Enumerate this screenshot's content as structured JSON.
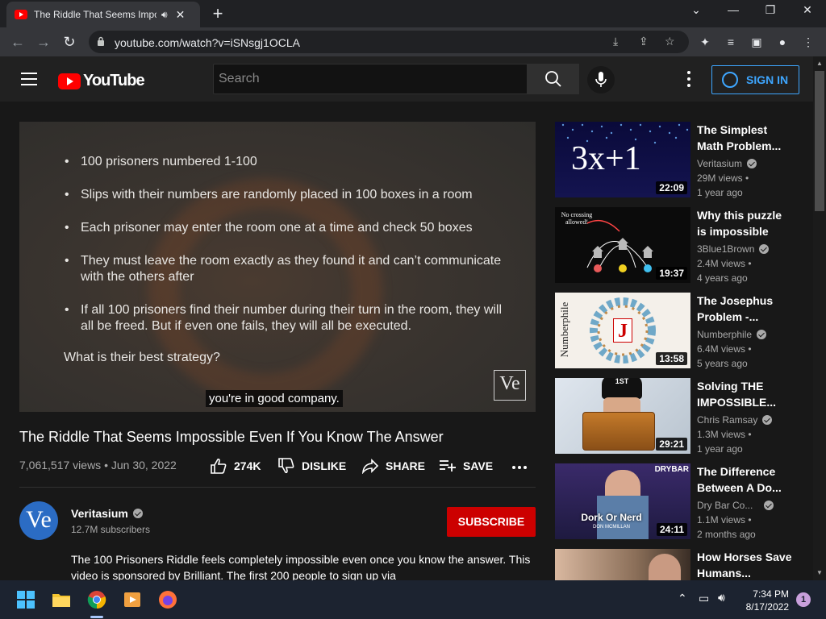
{
  "browser": {
    "tab_title": "The Riddle That Seems Impossible",
    "url": "youtube.com/watch?v=iSNsgj1OCLA"
  },
  "header": {
    "logo_text": "YouTube",
    "search_placeholder": "Search",
    "sign_in_label": "SIGN IN"
  },
  "video": {
    "slide_bullets": [
      "100 prisoners numbered 1-100",
      "Slips with their numbers are randomly placed in 100 boxes in a room",
      "Each prisoner may enter the room one at a time and check 50 boxes",
      "They must leave the room exactly as they found it and can’t communicate with the others after",
      "If all 100 prisoners find their number during their turn in the room, they will all be freed. But if even one fails, they will all be executed."
    ],
    "slide_question": "What is their best strategy?",
    "caption": "you're in good company.",
    "watermark": "Ve",
    "title": "The Riddle That Seems Impossible Even If You Know The Answer",
    "meta": "7,061,517 views • Jun 30, 2022",
    "likes": "274K",
    "dislike_label": "DISLIKE",
    "share_label": "SHARE",
    "save_label": "SAVE"
  },
  "channel": {
    "avatar_text": "Ve",
    "name": "Veritasium",
    "subscribers": "12.7M subscribers",
    "subscribe_label": "SUBSCRIBE",
    "description": "The 100 Prisoners Riddle feels completely impossible even once you know the answer. This video is sponsored by Brilliant. The first 200 people to sign up via"
  },
  "recommendations": [
    {
      "title": "The Simplest Math Problem...",
      "channel": "Veritasium",
      "views": "29M views •",
      "age": "1 year ago",
      "duration": "22:09",
      "thumb_text": "3x+1"
    },
    {
      "title": "Why this puzzle is impossible",
      "channel": "3Blue1Brown",
      "views": "2.4M views •",
      "age": "4 years ago",
      "duration": "19:37",
      "thumb_text": "No crossing allowed!"
    },
    {
      "title": "The Josephus Problem -...",
      "channel": "Numberphile",
      "views": "6.4M views •",
      "age": "5 years ago",
      "duration": "13:58",
      "thumb_text": "Numberphile",
      "thumb_letter": "J"
    },
    {
      "title": "Solving THE IMPOSSIBLE...",
      "channel": "Chris Ramsay",
      "views": "1.3M views •",
      "age": "1 year ago",
      "duration": "29:21",
      "thumb_text": "1ST"
    },
    {
      "title": "The Difference Between A Do...",
      "channel": "Dry Bar Co...",
      "views": "1.1M views •",
      "age": "2 months ago",
      "duration": "24:11",
      "thumb_text": "Dork Or Nerd",
      "thumb_sub": "DON MCMILLAN",
      "thumb_brand": "DRYBAR"
    },
    {
      "title": "How Horses Save Humans...",
      "channel": "",
      "views": "",
      "age": "",
      "duration": "",
      "thumb_text": ""
    }
  ],
  "taskbar": {
    "time": "7:34 PM",
    "date": "8/17/2022",
    "notifications": "1"
  }
}
